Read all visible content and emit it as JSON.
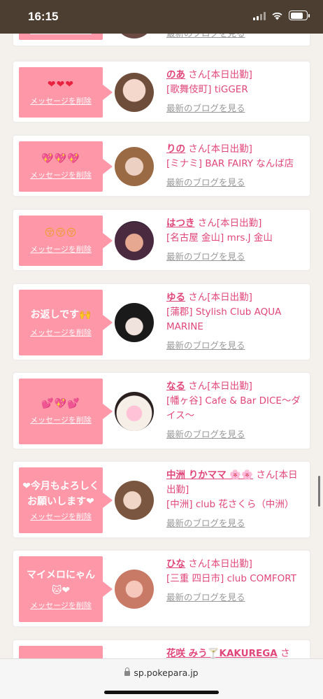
{
  "status": {
    "time": "16:15"
  },
  "browser": {
    "url": "sp.pokepara.jp"
  },
  "common": {
    "delete_label": "メッセージを削除",
    "blog_label": "最新のブログを見る",
    "san_label": "さん[本日出勤]"
  },
  "cards": [
    {
      "stamp_text": "",
      "name": "",
      "san": "",
      "store": ""
    },
    {
      "stamp_text": "❤❤❤",
      "name": "のあ",
      "san": "さん[本日出勤]",
      "store": "[歌舞伎町] tiGGER"
    },
    {
      "stamp_text": "💖💖💖",
      "name": "りの",
      "san": "さん[本日出勤]",
      "store": "[ミナミ] BAR FAIRY なんば店"
    },
    {
      "stamp_text": "😚😚😚",
      "name": "はつき",
      "san": "さん[本日出勤]",
      "store": "[名古屋 金山] mrs.J 金山"
    },
    {
      "stamp_text": "お返しです🙌",
      "name": "ゆる",
      "san": "さん[本日出勤]",
      "store": "[蒲郡] Stylish Club AQUA MARINE"
    },
    {
      "stamp_text": "💕💖💕",
      "name": "なる",
      "san": "さん[本日出勤]",
      "store": "[幡ヶ谷] Cafe & Bar DICE〜ダイス〜"
    },
    {
      "stamp_text": "❤今月もよろしくお願いします❤",
      "name": "中洲 りかママ 🌸🌸",
      "san": "さん[本日出勤]",
      "store": "[中洲] club 花さくら（中洲）"
    },
    {
      "stamp_text": "マイメロにゃん🐱❤",
      "name": "ひな",
      "san": "さん[本日出勤]",
      "store": "[三重 四日市] club COMFORT"
    },
    {
      "stamp_text": "",
      "name": "花咲 みう🍸KAKUREGA",
      "san": "さ",
      "store": ""
    }
  ],
  "colors": {
    "accent": "#e0467a",
    "stamp_bg": "#fe97a8",
    "status_bg": "#4d3e32"
  }
}
